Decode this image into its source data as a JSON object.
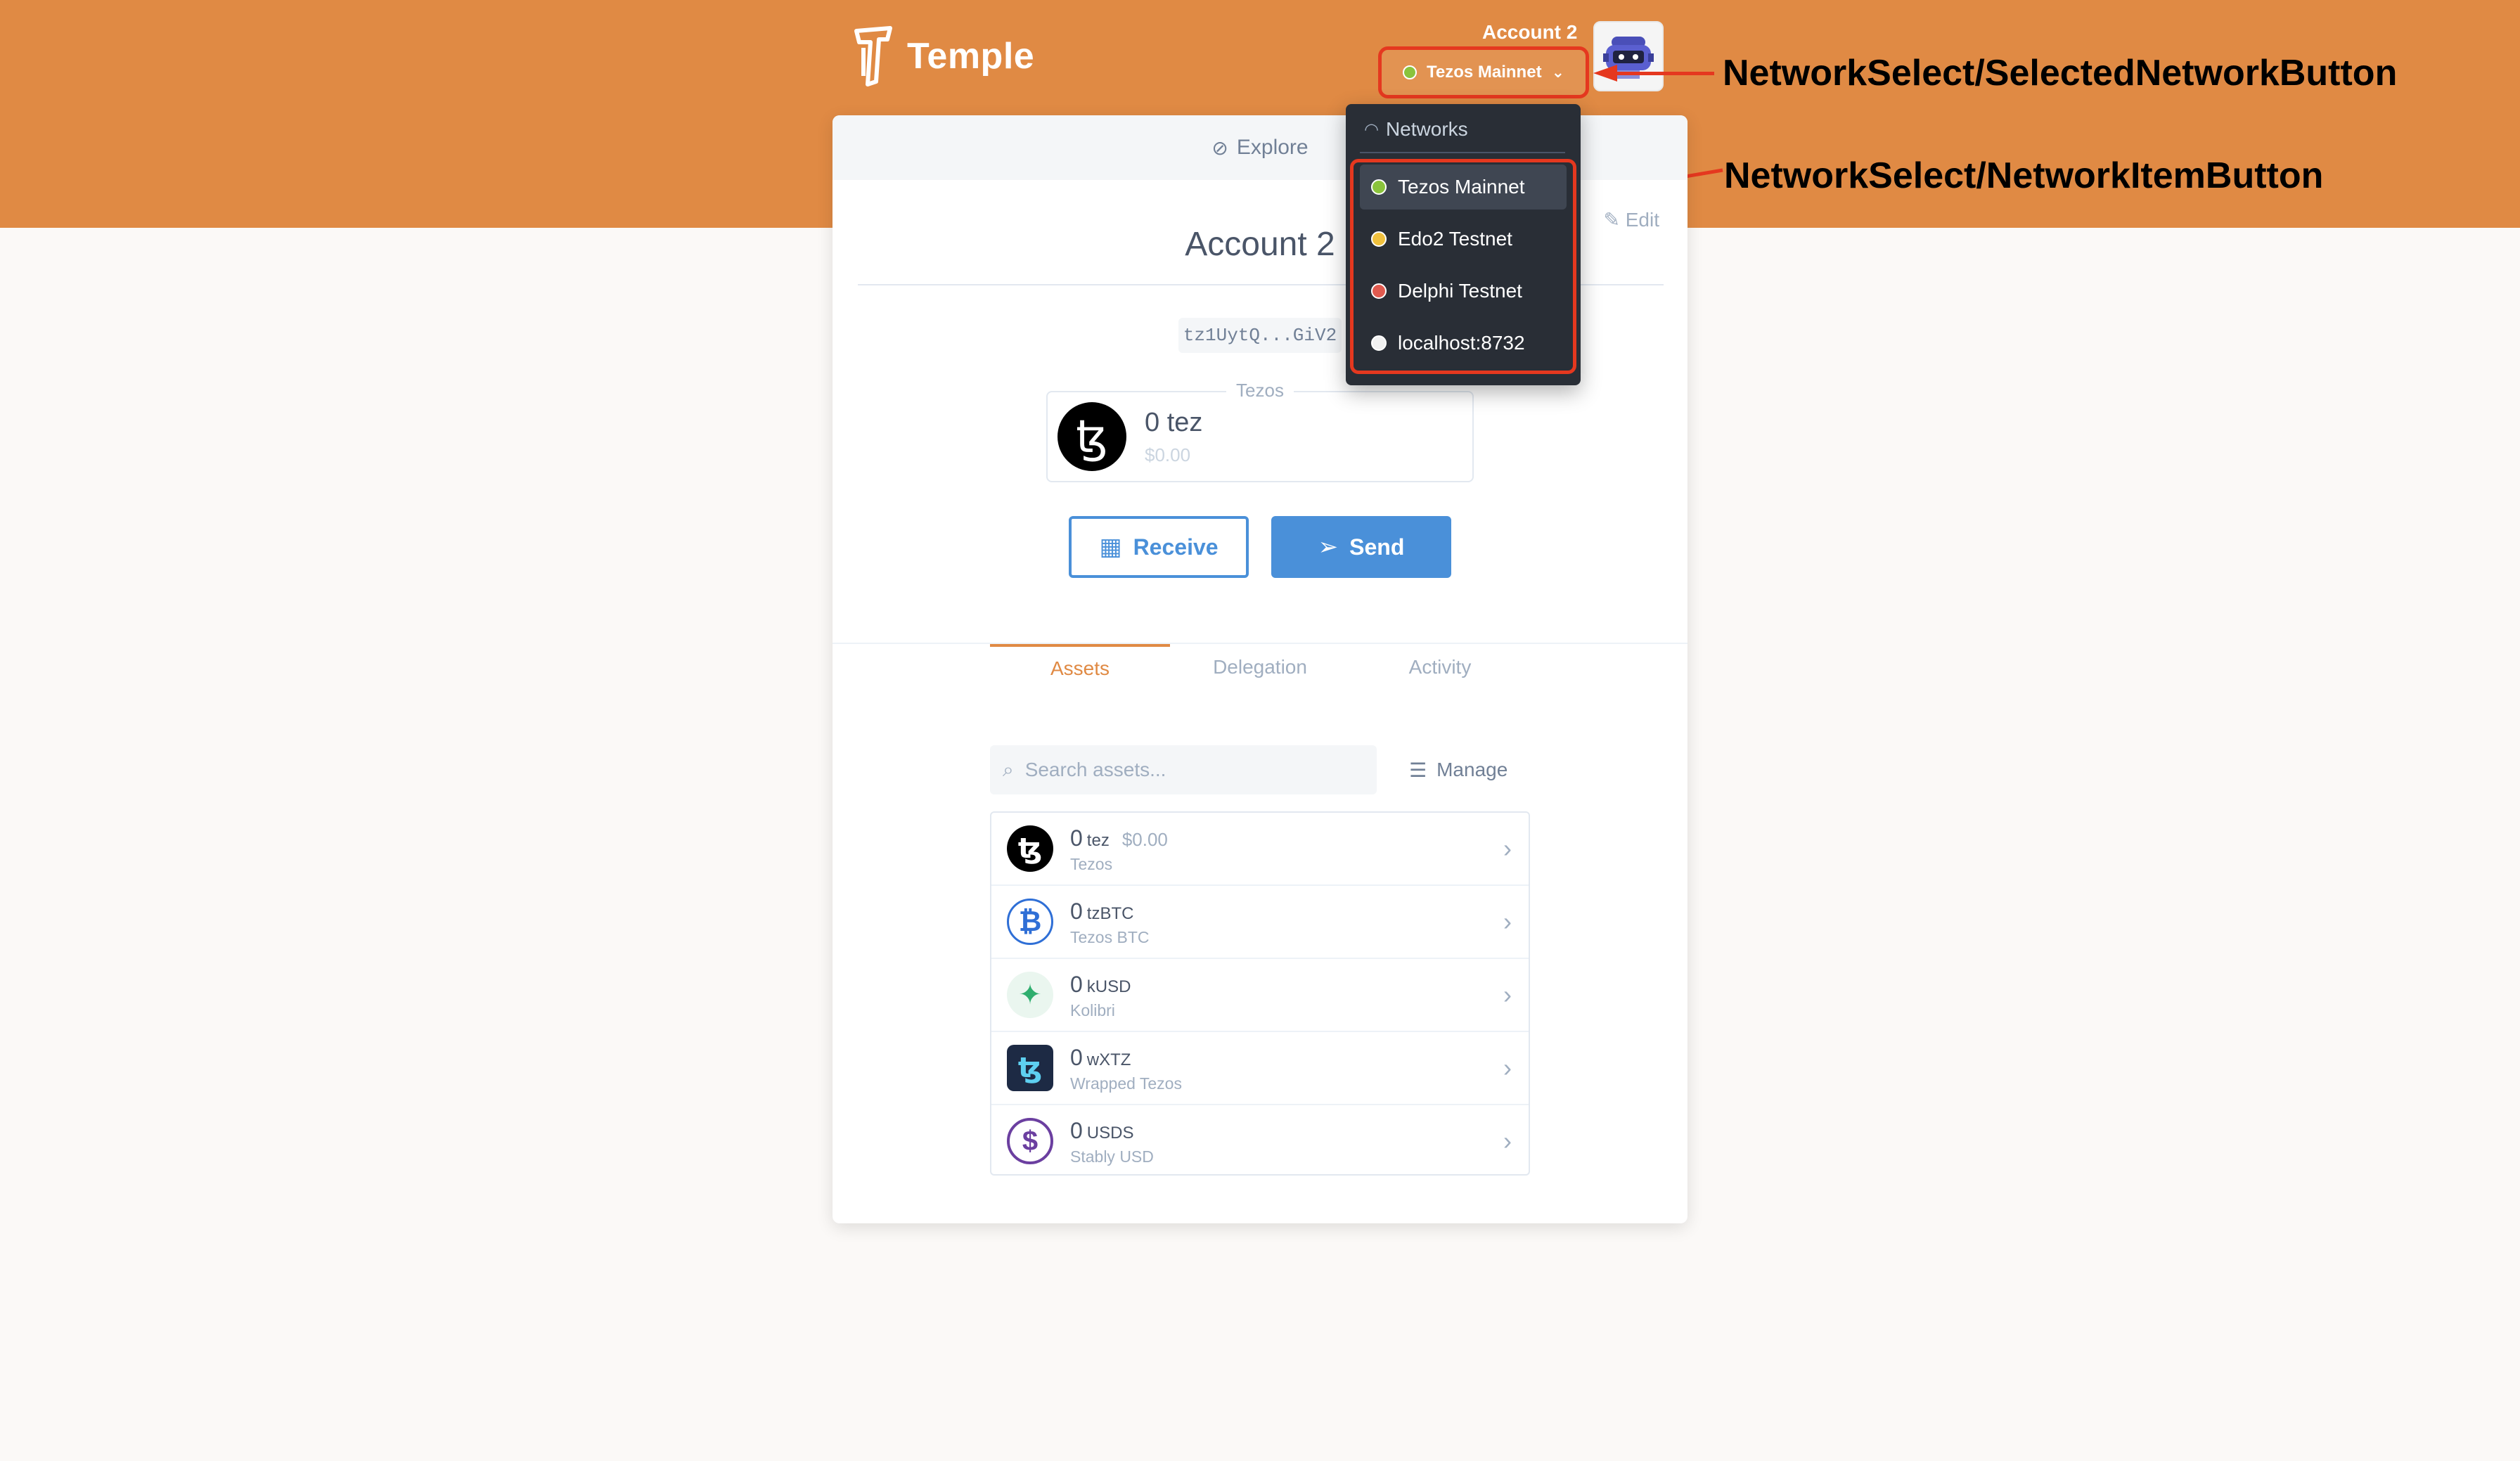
{
  "header": {
    "brand": "Temple",
    "account_name": "Account 2",
    "selected_network": "Tezos Mainnet",
    "selected_network_color": "#8ac33c"
  },
  "annotations": {
    "selected_network_button": "NetworkSelect/SelectedNetworkButton",
    "network_item_button": "NetworkSelect/NetworkItemButton"
  },
  "card": {
    "explore_label": "Explore",
    "account_title": "Account 2",
    "edit_label": "Edit",
    "address": "tz1UytQ...GiV2",
    "balance": {
      "legend": "Tezos",
      "amount": "0 tez",
      "usd": "$0.00"
    },
    "receive_label": "Receive",
    "send_label": "Send"
  },
  "tabs": [
    {
      "label": "Assets",
      "active": true
    },
    {
      "label": "Delegation",
      "active": false
    },
    {
      "label": "Activity",
      "active": false
    }
  ],
  "search": {
    "placeholder": "Search assets..."
  },
  "manage_label": "Manage",
  "assets": [
    {
      "amount": "0",
      "symbol": "tez",
      "usd": "$0.00",
      "name": "Tezos",
      "icon": "tezos-icon"
    },
    {
      "amount": "0",
      "symbol": "tzBTC",
      "usd": "",
      "name": "Tezos BTC",
      "icon": "tzbtc-icon"
    },
    {
      "amount": "0",
      "symbol": "kUSD",
      "usd": "",
      "name": "Kolibri",
      "icon": "kolibri-icon"
    },
    {
      "amount": "0",
      "symbol": "wXTZ",
      "usd": "",
      "name": "Wrapped Tezos",
      "icon": "wxtz-icon"
    },
    {
      "amount": "0",
      "symbol": "USDS",
      "usd": "",
      "name": "Stably USD",
      "icon": "usds-icon"
    }
  ],
  "networks": {
    "heading": "Networks",
    "items": [
      {
        "label": "Tezos Mainnet",
        "color": "#8ac33c",
        "selected": true
      },
      {
        "label": "Edo2 Testnet",
        "color": "#f0c13e",
        "selected": false
      },
      {
        "label": "Delphi Testnet",
        "color": "#e05a4f",
        "selected": false
      },
      {
        "label": "localhost:8732",
        "color": "#f1f1f1",
        "selected": false
      }
    ]
  },
  "colors": {
    "brand_orange": "#e08a44",
    "accent_blue": "#4a90d9",
    "annotation_red": "#e5381f"
  }
}
